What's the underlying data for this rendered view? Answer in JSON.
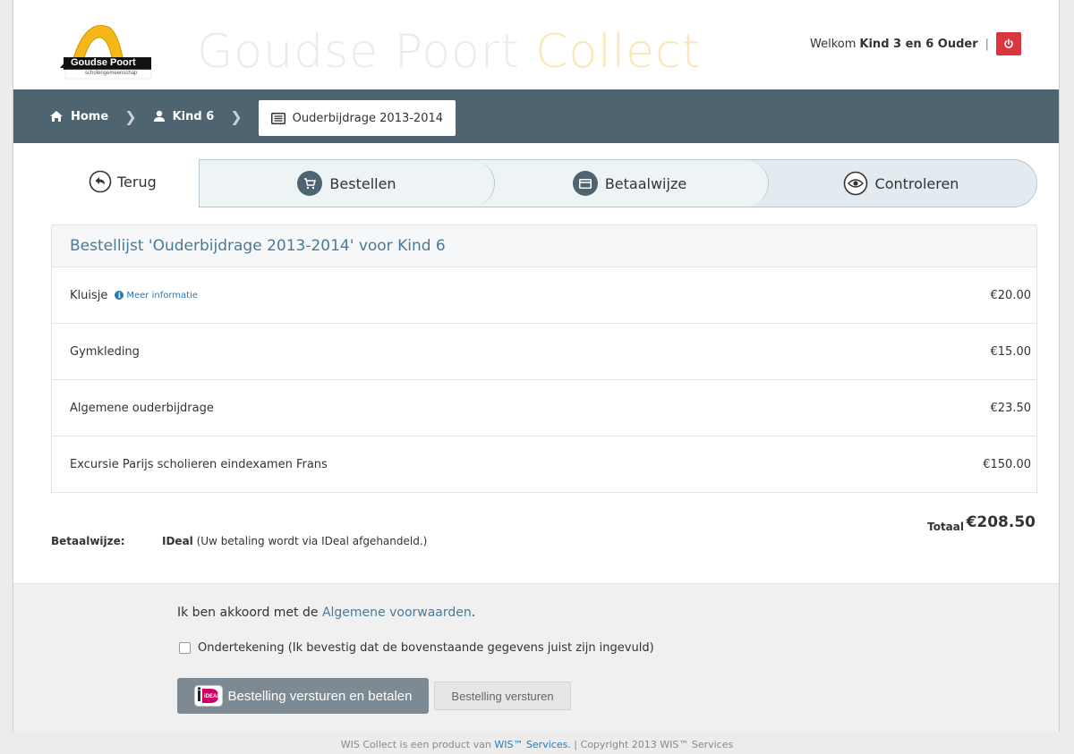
{
  "header": {
    "logo_text": "Goudse Poort",
    "logo_subtext": "scholengemeenschap",
    "title_part1": "Goudse Poort ",
    "title_part2": "Collect",
    "welcome_prefix": "Welkom",
    "user_name": "Kind 3 en 6 Ouder",
    "separator": "|",
    "power_icon": "power-icon"
  },
  "breadcrumb": {
    "home": "Home",
    "child": "Kind 6",
    "current": "Ouderbijdrage 2013-2014"
  },
  "steps": {
    "back": "Terug",
    "items": [
      {
        "label": "Bestellen",
        "icon": "cart-icon"
      },
      {
        "label": "Betaalwijze",
        "icon": "card-icon"
      },
      {
        "label": "Controleren",
        "icon": "eye-icon"
      }
    ]
  },
  "order": {
    "heading": "Bestellijst 'Ouderbijdrage 2013-2014' voor Kind 6",
    "more_info": "Meer informatie",
    "items": [
      {
        "name": "Kluisje",
        "price": "€20.00"
      },
      {
        "name": "Gymkleding",
        "price": "€15.00"
      },
      {
        "name": "Algemene ouderbijdrage",
        "price": "€23.50"
      },
      {
        "name": "Excursie Parijs scholieren eindexamen Frans",
        "price": "€150.00"
      }
    ],
    "total_label": "Totaal",
    "total_value": "€208.50",
    "payment_label": "Betaalwijze:",
    "payment_method": "IDeal",
    "payment_note": " (Uw betaling wordt via IDeal afgehandeld.)"
  },
  "actions": {
    "agree_prefix": "Ik ben akkoord met de ",
    "agree_link": "Algemene voorwaarden",
    "agree_suffix": ".",
    "signature_label": "Ondertekening (Ik bevestig dat de bovenstaande gegevens juist zijn ingevuld)",
    "pay_button": "Bestelling versturen en betalen",
    "send_button": "Bestelling versturen"
  },
  "footer": {
    "prefix": "WIS Collect is een product van ",
    "link": "WIS™ Services.",
    "suffix": " | Copyright 2013 WIS™ Services"
  },
  "colors": {
    "nav_bar": "#4f6471",
    "accent_link": "#4b7a96",
    "power_button": "#d9363e",
    "title_gold": "#fde5b6"
  }
}
